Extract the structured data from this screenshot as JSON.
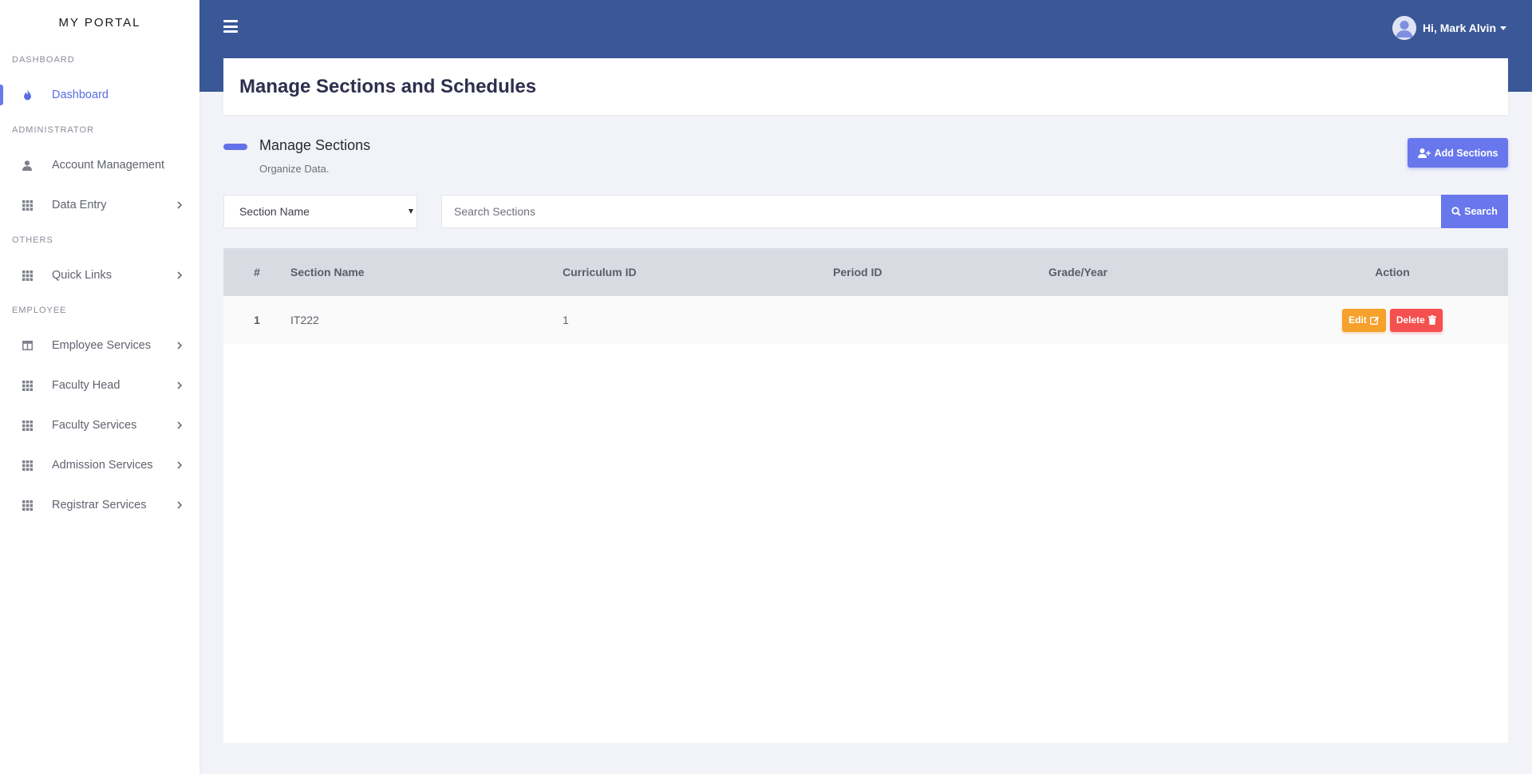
{
  "brand": "MY PORTAL",
  "sidebar": {
    "sections": [
      {
        "heading": "DASHBOARD",
        "items": [
          {
            "label": "Dashboard",
            "icon": "fire-icon",
            "active": true
          }
        ]
      },
      {
        "heading": "ADMINISTRATOR",
        "items": [
          {
            "label": "Account Management",
            "icon": "user-icon"
          },
          {
            "label": "Data Entry",
            "icon": "grid-icon",
            "chevron": true
          }
        ]
      },
      {
        "heading": "OTHERS",
        "items": [
          {
            "label": "Quick Links",
            "icon": "grid-icon",
            "chevron": true
          }
        ]
      },
      {
        "heading": "EMPLOYEE",
        "items": [
          {
            "label": "Employee Services",
            "icon": "table-icon",
            "chevron": true
          },
          {
            "label": "Faculty Head",
            "icon": "grid-icon",
            "chevron": true
          },
          {
            "label": "Faculty Services",
            "icon": "grid-icon",
            "chevron": true
          },
          {
            "label": "Admission Services",
            "icon": "grid-icon",
            "chevron": true
          },
          {
            "label": "Registrar Services",
            "icon": "grid-icon",
            "chevron": true
          }
        ]
      }
    ]
  },
  "header": {
    "user_greeting": "Hi, Mark Alvin"
  },
  "page": {
    "title": "Manage Sections and Schedules",
    "section_title": "Manage Sections",
    "section_subtitle": "Organize Data.",
    "add_button": "Add Sections"
  },
  "filter": {
    "select_value": "Section Name",
    "search_placeholder": "Search Sections",
    "search_button": "Search"
  },
  "table": {
    "headers": [
      "#",
      "Section Name",
      "Curriculum ID",
      "Period ID",
      "Grade/Year",
      "Action"
    ],
    "rows": [
      {
        "num": "1",
        "section_name": "IT222",
        "curriculum_id": "1",
        "period_id": "",
        "grade_year": ""
      }
    ],
    "edit_label": "Edit",
    "delete_label": "Delete"
  },
  "colors": {
    "header_bg": "#3a5797",
    "accent": "#6877ec",
    "edit": "#f6a12b",
    "delete": "#f4504f"
  }
}
